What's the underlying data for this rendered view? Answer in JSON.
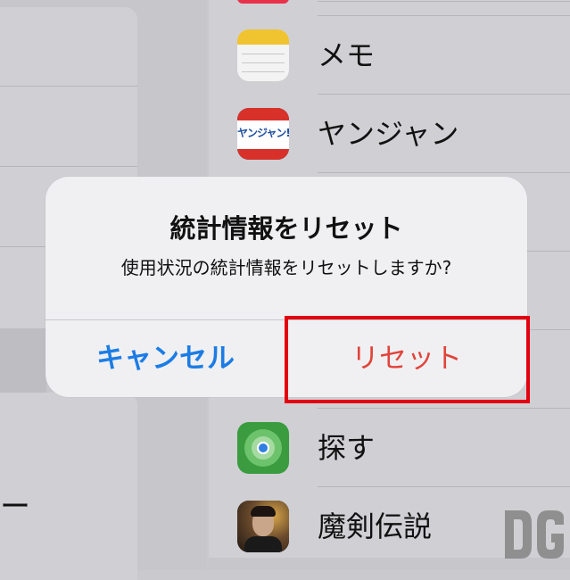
{
  "left_pane": {
    "partial_label": "ー"
  },
  "app_list": [
    {
      "label": "メモ",
      "icon": "notes-icon"
    },
    {
      "label": "ヤンジャン",
      "icon": "yanjan-icon",
      "icon_text": "ヤンジャン!"
    },
    {
      "label": "探す",
      "icon": "find-my-icon"
    },
    {
      "label": "魔剣伝説",
      "icon": "game-icon"
    }
  ],
  "alert": {
    "title": "統計情報をリセット",
    "message": "使用状況の統計情報をリセットしますか?",
    "cancel_label": "キャンセル",
    "reset_label": "リセット"
  },
  "colors": {
    "accent_blue": "#1c7ce5",
    "destructive_red": "#e0433a",
    "highlight_red": "#e3000f"
  }
}
